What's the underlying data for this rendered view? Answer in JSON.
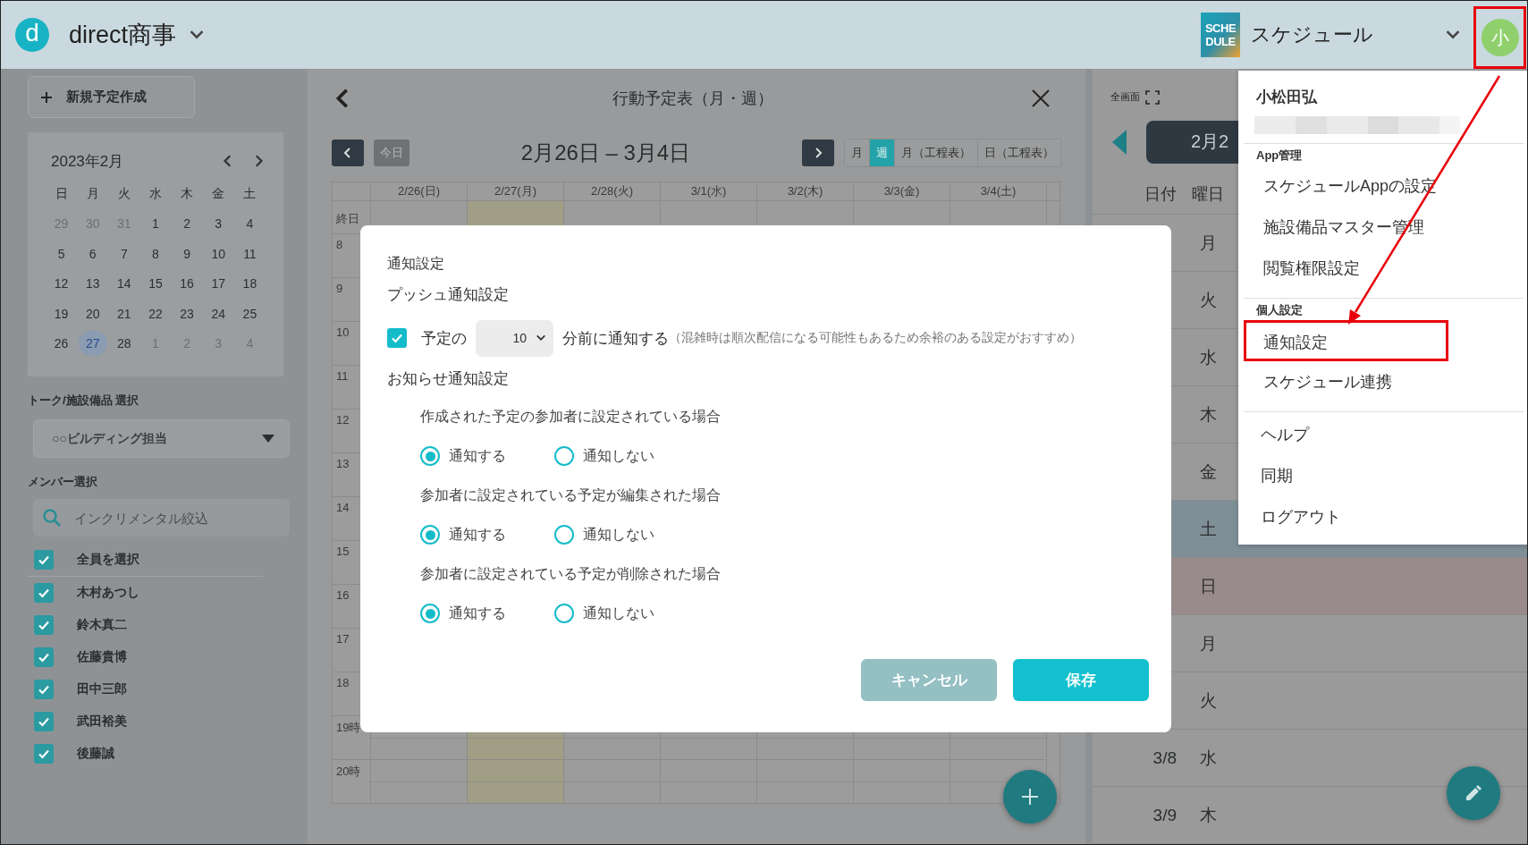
{
  "header": {
    "logo_letter": "d",
    "company": "direct商事",
    "app_logo": [
      "SCHE",
      "DULE"
    ],
    "app_name": "スケジュール",
    "avatar": "小",
    "avatar_annotated": true
  },
  "sidebar": {
    "new_button": "新規予定作成",
    "calendar": {
      "title": "2023年2月",
      "weekdays": [
        "日",
        "月",
        "火",
        "水",
        "木",
        "金",
        "土"
      ],
      "weeks": [
        [
          {
            "day": "29",
            "current_month": false,
            "selected": false
          },
          {
            "day": "30",
            "current_month": false,
            "selected": false
          },
          {
            "day": "31",
            "current_month": false,
            "selected": false
          },
          {
            "day": "1",
            "current_month": true,
            "selected": false
          },
          {
            "day": "2",
            "current_month": true,
            "selected": false
          },
          {
            "day": "3",
            "current_month": true,
            "selected": false
          },
          {
            "day": "4",
            "current_month": true,
            "selected": false
          }
        ],
        [
          {
            "day": "5",
            "current_month": true,
            "selected": false
          },
          {
            "day": "6",
            "current_month": true,
            "selected": false
          },
          {
            "day": "7",
            "current_month": true,
            "selected": false
          },
          {
            "day": "8",
            "current_month": true,
            "selected": false
          },
          {
            "day": "9",
            "current_month": true,
            "selected": false
          },
          {
            "day": "10",
            "current_month": true,
            "selected": false
          },
          {
            "day": "11",
            "current_month": true,
            "selected": false
          }
        ],
        [
          {
            "day": "12",
            "current_month": true,
            "selected": false
          },
          {
            "day": "13",
            "current_month": true,
            "selected": false
          },
          {
            "day": "14",
            "current_month": true,
            "selected": false
          },
          {
            "day": "15",
            "current_month": true,
            "selected": false
          },
          {
            "day": "16",
            "current_month": true,
            "selected": false
          },
          {
            "day": "17",
            "current_month": true,
            "selected": false
          },
          {
            "day": "18",
            "current_month": true,
            "selected": false
          }
        ],
        [
          {
            "day": "19",
            "current_month": true,
            "selected": false
          },
          {
            "day": "20",
            "current_month": true,
            "selected": false
          },
          {
            "day": "21",
            "current_month": true,
            "selected": false
          },
          {
            "day": "22",
            "current_month": true,
            "selected": false
          },
          {
            "day": "23",
            "current_month": true,
            "selected": false
          },
          {
            "day": "24",
            "current_month": true,
            "selected": false
          },
          {
            "day": "25",
            "current_month": true,
            "selected": false
          }
        ],
        [
          {
            "day": "26",
            "current_month": true,
            "selected": false
          },
          {
            "day": "27",
            "current_month": true,
            "selected": true
          },
          {
            "day": "28",
            "current_month": true,
            "selected": false
          },
          {
            "day": "1",
            "current_month": false,
            "selected": false
          },
          {
            "day": "2",
            "current_month": false,
            "selected": false
          },
          {
            "day": "3",
            "current_month": false,
            "selected": false
          },
          {
            "day": "4",
            "current_month": false,
            "selected": false
          }
        ]
      ]
    },
    "talk_label": "トーク/施設備品 選択",
    "talk_select": "○○ビルディング担当",
    "member_label": "メンバー選択",
    "search": {
      "placeholder": "インクリメンタル絞込"
    },
    "members": [
      {
        "name": "全員を選択",
        "checked": true
      },
      {
        "name": "木村あつし",
        "checked": true
      },
      {
        "name": "鈴木真二",
        "checked": true
      },
      {
        "name": "佐藤貴博",
        "checked": true
      },
      {
        "name": "田中三郎",
        "checked": true
      },
      {
        "name": "武田裕美",
        "checked": true
      },
      {
        "name": "後藤誠",
        "checked": true
      }
    ]
  },
  "schedule": {
    "title": "行動予定表（月・週）",
    "today_button": "今日",
    "range": "2月26日 – 3月4日",
    "views": [
      {
        "label": "月",
        "selected": false
      },
      {
        "label": "週",
        "selected": true
      },
      {
        "label": "月（工程表）",
        "selected": false
      },
      {
        "label": "日（工程表）",
        "selected": false
      }
    ],
    "days": [
      {
        "label": "2/26(日)",
        "today": false
      },
      {
        "label": "2/27(月)",
        "today": true
      },
      {
        "label": "2/28(火)",
        "today": false
      },
      {
        "label": "3/1(水)",
        "today": false
      },
      {
        "label": "3/2(木)",
        "today": false
      },
      {
        "label": "3/3(金)",
        "today": false
      },
      {
        "label": "3/4(土)",
        "today": false
      }
    ],
    "all_day_label": "終日",
    "hours": [
      "8",
      "9",
      "10",
      "11",
      "12",
      "13",
      "14",
      "15",
      "16",
      "17",
      "18",
      "19時",
      "20時"
    ]
  },
  "right_panel": {
    "fullscreen_label": "全画面",
    "date_pill": "2月2",
    "columns": [
      "日付",
      "曜日"
    ],
    "rows": [
      {
        "weekday": "月",
        "kind": "weekday"
      },
      {
        "weekday": "火",
        "kind": "weekday"
      },
      {
        "weekday": "水",
        "kind": "weekday"
      },
      {
        "weekday": "木",
        "kind": "weekday"
      },
      {
        "weekday": "金",
        "kind": "weekday"
      },
      {
        "weekday": "土",
        "kind": "saturday"
      },
      {
        "weekday": "日",
        "kind": "sunday"
      },
      {
        "weekday": "月",
        "kind": "weekday"
      },
      {
        "weekday": "火",
        "kind": "weekday"
      },
      {
        "date": "3/8",
        "weekday": "水",
        "kind": "weekday"
      },
      {
        "date": "3/9",
        "weekday": "木",
        "kind": "weekday"
      }
    ]
  },
  "modal": {
    "title": "通知設定",
    "push_heading": "プッシュ通知設定",
    "push": {
      "checked": true,
      "prefix": "予定の",
      "minutes": "10",
      "suffix": "分前に通知する",
      "note": "（混雑時は順次配信になる可能性もあるため余裕のある設定がおすすめ）"
    },
    "notice_heading": "お知らせ通知設定",
    "groups": [
      {
        "question": "作成された予定の参加者に設定されている場合",
        "options": [
          {
            "label": "通知する",
            "selected": true
          },
          {
            "label": "通知しない",
            "selected": false
          }
        ]
      },
      {
        "question": "参加者に設定されている予定が編集された場合",
        "options": [
          {
            "label": "通知する",
            "selected": true
          },
          {
            "label": "通知しない",
            "selected": false
          }
        ]
      },
      {
        "question": "参加者に設定されている予定が削除された場合",
        "options": [
          {
            "label": "通知する",
            "selected": true
          },
          {
            "label": "通知しない",
            "selected": false
          }
        ]
      }
    ],
    "buttons": [
      {
        "label": "キャンセル",
        "kind": "secondary"
      },
      {
        "label": "保存",
        "kind": "primary"
      }
    ]
  },
  "menu": {
    "user_name": "小松田弘",
    "sections": [
      {
        "heading": "App管理",
        "items": [
          {
            "label": "スケジュールAppの設定",
            "annotated": false
          },
          {
            "label": "施設備品マスター管理",
            "annotated": false
          },
          {
            "label": "閲覧権限設定",
            "annotated": false
          }
        ]
      },
      {
        "heading": "個人設定",
        "items": [
          {
            "label": "通知設定",
            "annotated": true
          },
          {
            "label": "スケジュール連携",
            "annotated": false
          }
        ]
      },
      {
        "items": [
          {
            "label": "ヘルプ",
            "annotated": false
          },
          {
            "label": "同期",
            "annotated": false
          },
          {
            "label": "ログアウト",
            "annotated": false
          }
        ]
      }
    ]
  }
}
